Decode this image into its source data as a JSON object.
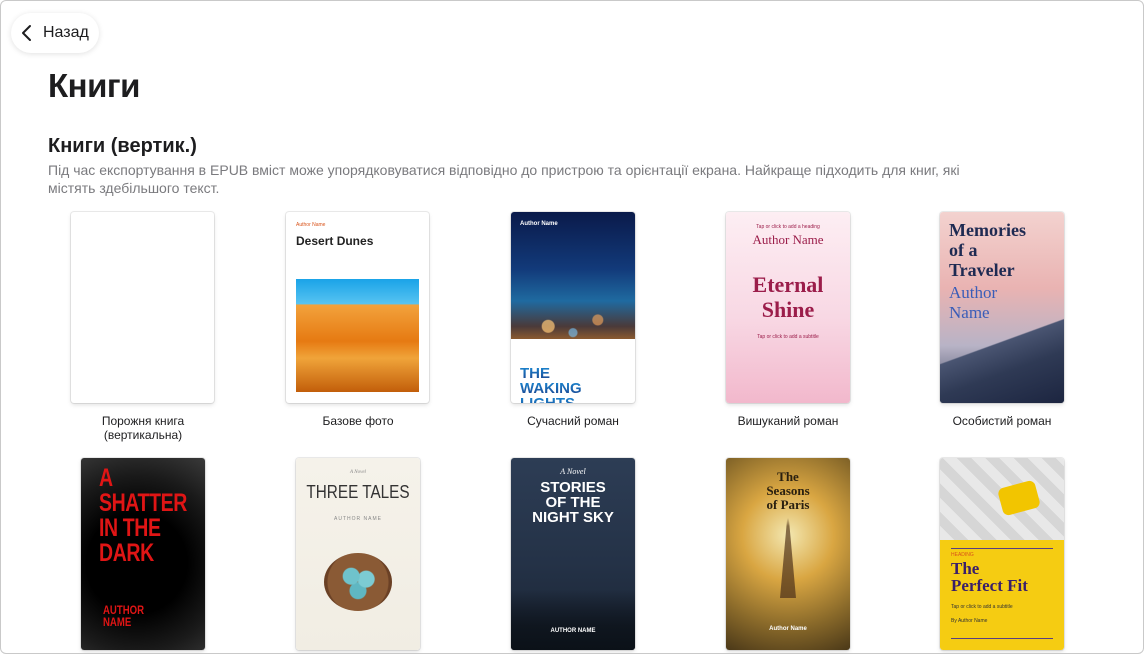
{
  "nav": {
    "back_label": "Назад"
  },
  "page": {
    "title": "Книги"
  },
  "section": {
    "title": "Книги (вертик.)",
    "description": "Під час експортування в EPUB вміст може упорядковуватися відповідно до пристрою та орієнтації екрана. Найкраще підходить для книг, які містять здебільшого текст."
  },
  "templates": [
    {
      "caption": "Порожня книга\n(вертикальна)"
    },
    {
      "caption": "Базове фото",
      "cover_author": "Author Name",
      "cover_title": "Desert Dunes"
    },
    {
      "caption": "Сучасний роман",
      "cover_author": "Author Name",
      "cover_title": "THE\nWAKING\nLIGHTS"
    },
    {
      "caption": "Вишуканий роман",
      "cover_heading_hint": "Tap or click to add a heading",
      "cover_author": "Author Name",
      "cover_title": "Eternal\nShine",
      "cover_subtitle_hint": "Tap or click to add a subtitle"
    },
    {
      "caption": "Особистий роман",
      "cover_title": "Memories\nof a\nTraveler",
      "cover_author": "Author\nName"
    },
    {
      "cover_title": "A\nSHATTER\nIN THE\nDARK",
      "cover_author": "AUTHOR\nNAME"
    },
    {
      "cover_kicker": "A Novel",
      "cover_title": "THREE TALES",
      "cover_author": "AUTHOR NAME"
    },
    {
      "cover_kicker": "A Novel",
      "cover_title": "STORIES\nOF THE\nNIGHT SKY",
      "cover_author": "AUTHOR NAME"
    },
    {
      "cover_title": "The\nSeasons\nof Paris",
      "cover_author": "Author Name"
    },
    {
      "cover_kicker": "HEADING",
      "cover_title": "The\nPerfect Fit",
      "cover_subtitle_hint": "Tap or click to add a subtitle",
      "cover_author": "By Author Name"
    }
  ],
  "colors": {
    "accent_red": "#e01515",
    "magenta": "#9b1d4a",
    "navy": "#1e2a52"
  }
}
